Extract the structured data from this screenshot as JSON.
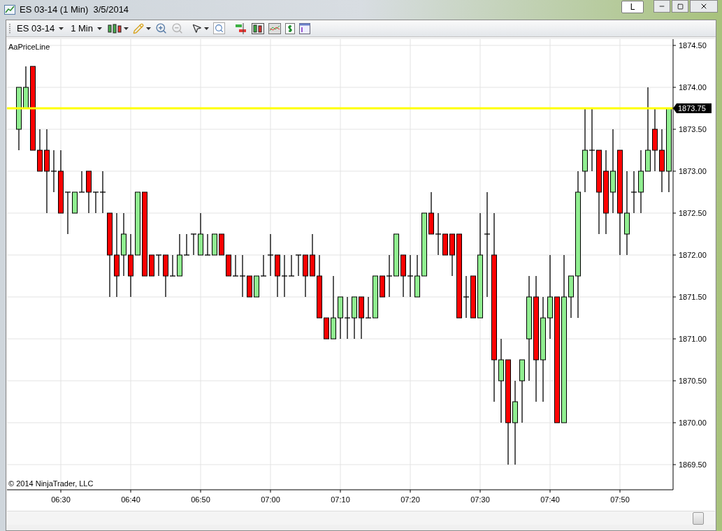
{
  "window": {
    "title": "ES 03-14 (1 Min)  3/5/2014",
    "mode_button": "L"
  },
  "toolbar": {
    "instrument": "ES 03-14",
    "interval": "1 Min"
  },
  "chart": {
    "indicator": "AaPriceLine",
    "copyright": "© 2014 NinjaTrader, LLC",
    "chart_data": {
      "type": "candlestick",
      "grid": true,
      "xlim": [
        382.3,
        477.6
      ],
      "ylim": [
        1869.2,
        1874.575
      ],
      "x": [
        384,
        385,
        386,
        387,
        388,
        389,
        390,
        391,
        392,
        393,
        394,
        395,
        396,
        397,
        398,
        399,
        400,
        401,
        402,
        403,
        404,
        405,
        406,
        407,
        408,
        409,
        410,
        411,
        412,
        413,
        414,
        415,
        416,
        417,
        418,
        419,
        420,
        421,
        422,
        423,
        424,
        425,
        426,
        427,
        428,
        429,
        430,
        431,
        432,
        433,
        434,
        435,
        436,
        437,
        438,
        439,
        440,
        441,
        442,
        443,
        444,
        445,
        446,
        447,
        448,
        449,
        450,
        451,
        452,
        453,
        454,
        455,
        456,
        457,
        458,
        459,
        460,
        461,
        462,
        463,
        464,
        465,
        466,
        467,
        468,
        469,
        470,
        471,
        472,
        473,
        474,
        475,
        476,
        477
      ],
      "ohlc": [
        [
          1873.5,
          1874,
          1873.25,
          1874
        ],
        [
          1873.75,
          1874.25,
          1873.75,
          1874
        ],
        [
          1874.25,
          1874.25,
          1873.25,
          1873.25
        ],
        [
          1873.25,
          1873.5,
          1873,
          1873
        ],
        [
          1873.25,
          1873.5,
          1872.5,
          1873
        ],
        [
          1873,
          1873.25,
          1872.75,
          1873
        ],
        [
          1873,
          1873.25,
          1872.5,
          1872.5
        ],
        [
          1872.75,
          1872.75,
          1872.25,
          1872.75
        ],
        [
          1872.5,
          1872.75,
          1872.5,
          1872.75
        ],
        [
          1872.75,
          1873,
          1872.75,
          1872.75
        ],
        [
          1873,
          1873,
          1872.5,
          1872.75
        ],
        [
          1872.75,
          1872.75,
          1872.5,
          1872.75
        ],
        [
          1872.75,
          1873,
          1872.5,
          1872.75
        ],
        [
          1872.5,
          1872.5,
          1871.5,
          1872
        ],
        [
          1872,
          1872.5,
          1871.5,
          1871.75
        ],
        [
          1872,
          1872.5,
          1871.75,
          1872.25
        ],
        [
          1872,
          1872.25,
          1871.5,
          1871.75
        ],
        [
          1872,
          1872.75,
          1872,
          1872.75
        ],
        [
          1872.75,
          1872.75,
          1871.75,
          1871.75
        ],
        [
          1872,
          1872,
          1871.75,
          1871.75
        ],
        [
          1872,
          1872,
          1871.75,
          1872
        ],
        [
          1872,
          1872,
          1871.5,
          1871.75
        ],
        [
          1871.75,
          1872,
          1871.75,
          1871.75
        ],
        [
          1871.75,
          1872.25,
          1871.75,
          1872
        ],
        [
          1872,
          1872.25,
          1872,
          1872
        ],
        [
          1872.25,
          1872.25,
          1872,
          1872.25
        ],
        [
          1872,
          1872.5,
          1872,
          1872.25
        ],
        [
          1872,
          1872.25,
          1872,
          1872
        ],
        [
          1872,
          1872.25,
          1872,
          1872.25
        ],
        [
          1872.25,
          1872.25,
          1872,
          1872
        ],
        [
          1872,
          1872,
          1871.75,
          1871.75
        ],
        [
          1871.75,
          1872,
          1871.75,
          1871.75
        ],
        [
          1871.75,
          1872,
          1871.5,
          1871.75
        ],
        [
          1871.75,
          1871.75,
          1871.5,
          1871.5
        ],
        [
          1871.5,
          1871.75,
          1871.5,
          1871.75
        ],
        [
          1871.75,
          1872,
          1871.75,
          1871.75
        ],
        [
          1872,
          1872.25,
          1871.75,
          1872
        ],
        [
          1872,
          1872,
          1871.5,
          1871.75
        ],
        [
          1871.75,
          1872,
          1871.5,
          1871.75
        ],
        [
          1871.75,
          1872,
          1871.75,
          1871.75
        ],
        [
          1872,
          1872,
          1871.75,
          1872
        ],
        [
          1872,
          1872,
          1871.5,
          1871.75
        ],
        [
          1872,
          1872.25,
          1871.75,
          1871.75
        ],
        [
          1871.75,
          1872,
          1871.25,
          1871.25
        ],
        [
          1871.25,
          1871.25,
          1871,
          1871
        ],
        [
          1871,
          1871.75,
          1871,
          1871.25
        ],
        [
          1871.25,
          1871.5,
          1871,
          1871.5
        ],
        [
          1871.25,
          1871.5,
          1871,
          1871.25
        ],
        [
          1871.25,
          1871.5,
          1871,
          1871.5
        ],
        [
          1871.5,
          1871.5,
          1871,
          1871.25
        ],
        [
          1871.25,
          1871.5,
          1871.25,
          1871.25
        ],
        [
          1871.25,
          1871.75,
          1871.25,
          1871.75
        ],
        [
          1871.75,
          1871.75,
          1871.5,
          1871.5
        ],
        [
          1871.75,
          1872,
          1871.5,
          1871.75
        ],
        [
          1871.75,
          1872.25,
          1871.75,
          1872.25
        ],
        [
          1872,
          1872,
          1871.5,
          1871.75
        ],
        [
          1871.75,
          1872,
          1871.5,
          1871.75
        ],
        [
          1871.5,
          1872,
          1871.5,
          1871.75
        ],
        [
          1871.75,
          1872.5,
          1871.75,
          1872.5
        ],
        [
          1872.5,
          1872.75,
          1872.25,
          1872.25
        ],
        [
          1872.25,
          1872.5,
          1872,
          1872.25
        ],
        [
          1872.25,
          1872.25,
          1872,
          1872
        ],
        [
          1872.25,
          1872.25,
          1871.75,
          1872
        ],
        [
          1872.25,
          1872.25,
          1871.25,
          1871.25
        ],
        [
          1871.5,
          1871.75,
          1871.25,
          1871.5
        ],
        [
          1871.75,
          1871.75,
          1871.25,
          1871.25
        ],
        [
          1871.25,
          1872.5,
          1871.25,
          1872
        ],
        [
          1872.25,
          1872.75,
          1871.5,
          1872.25
        ],
        [
          1872,
          1872.5,
          1870.25,
          1870.75
        ],
        [
          1870.5,
          1871,
          1870,
          1870.75
        ],
        [
          1870.75,
          1870.75,
          1869.5,
          1870
        ],
        [
          1870,
          1870.5,
          1869.5,
          1870.25
        ],
        [
          1870.5,
          1870.75,
          1870,
          1870.75
        ],
        [
          1871,
          1871.75,
          1870.5,
          1871.5
        ],
        [
          1871.5,
          1871.75,
          1870.25,
          1870.75
        ],
        [
          1870.75,
          1871.5,
          1870.25,
          1871.25
        ],
        [
          1871.25,
          1872,
          1871,
          1871.5
        ],
        [
          1871.5,
          1871.5,
          1870,
          1870
        ],
        [
          1870,
          1872,
          1870,
          1871.5
        ],
        [
          1871.5,
          1871.75,
          1871.25,
          1871.75
        ],
        [
          1871.75,
          1873,
          1871.25,
          1872.75
        ],
        [
          1873,
          1873.75,
          1872.75,
          1873.25
        ],
        [
          1873.25,
          1873.75,
          1873,
          1873.25
        ],
        [
          1873.25,
          1873.25,
          1872.25,
          1872.75
        ],
        [
          1873,
          1873.25,
          1872.25,
          1872.5
        ],
        [
          1872.75,
          1873.5,
          1872.5,
          1873
        ],
        [
          1873.25,
          1873.25,
          1872,
          1872.5
        ],
        [
          1872.25,
          1873,
          1872,
          1872.5
        ],
        [
          1872.75,
          1873,
          1872.5,
          1872.75
        ],
        [
          1872.75,
          1873.25,
          1872.5,
          1873
        ],
        [
          1873,
          1874,
          1873,
          1873.25
        ],
        [
          1873.5,
          1873.75,
          1873,
          1873.25
        ],
        [
          1873.25,
          1873.5,
          1872.75,
          1873
        ],
        [
          1873,
          1873.75,
          1872.75,
          1873.75
        ]
      ],
      "xticks": [
        {
          "value": 390,
          "label": "06:30"
        },
        {
          "value": 400,
          "label": "06:40"
        },
        {
          "value": 410,
          "label": "06:50"
        },
        {
          "value": 420,
          "label": "07:00"
        },
        {
          "value": 430,
          "label": "07:10"
        },
        {
          "value": 440,
          "label": "07:20"
        },
        {
          "value": 450,
          "label": "07:30"
        },
        {
          "value": 460,
          "label": "07:40"
        },
        {
          "value": 470,
          "label": "07:50"
        }
      ],
      "yticks": [
        {
          "value": 1869.5,
          "label": "1869.50"
        },
        {
          "value": 1870,
          "label": "1870.00"
        },
        {
          "value": 1870.5,
          "label": "1870.50"
        },
        {
          "value": 1871,
          "label": "1871.00"
        },
        {
          "value": 1871.5,
          "label": "1871.50"
        },
        {
          "value": 1872,
          "label": "1872.00"
        },
        {
          "value": 1872.5,
          "label": "1872.50"
        },
        {
          "value": 1873,
          "label": "1873.00"
        },
        {
          "value": 1873.5,
          "label": "1873.50"
        },
        {
          "value": 1874,
          "label": "1874.00"
        },
        {
          "value": 1874.5,
          "label": "1874.50"
        }
      ],
      "ref_lines": [
        {
          "axis": "y",
          "value": 1873.75,
          "label": "1873.75"
        }
      ]
    }
  }
}
